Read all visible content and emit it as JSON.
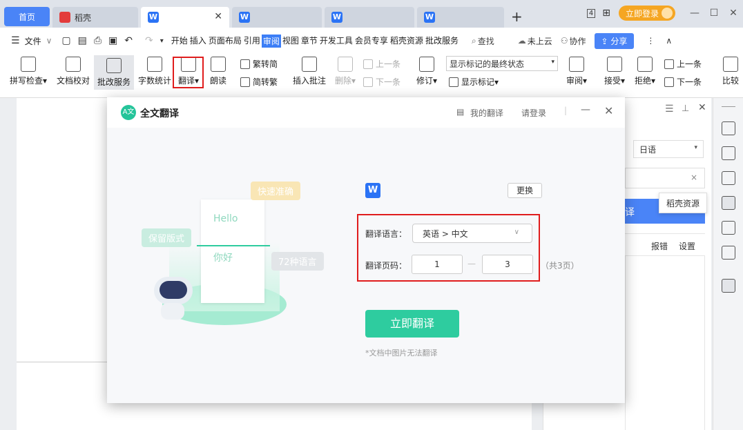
{
  "tabs": {
    "home": "首页",
    "docer": "稻壳",
    "doc_icon": "W"
  },
  "topbar": {
    "login": "立即登录",
    "grid_icon": "grid-icon",
    "window_icon": "4"
  },
  "menu": {
    "file": "文件",
    "items": [
      "开始",
      "插入",
      "页面布局",
      "引用",
      "审阅",
      "视图",
      "章节",
      "开发工具",
      "会员专享",
      "稻壳资源",
      "批改服务"
    ],
    "active": "审阅",
    "search": "查找",
    "cloud": "未上云",
    "collab": "协作",
    "share": "分享"
  },
  "ribbon": {
    "spell_check": "拼写检查",
    "doc_proof": "文档校对",
    "correction": "批改服务",
    "word_count": "字数统计",
    "translate": "翻译",
    "read_aloud": "朗读",
    "trad_to_simp": "繁转简",
    "simp_to_trad": "简转繁",
    "insert_comment": "插入批注",
    "delete": "删除",
    "prev": "上一条",
    "next": "下一条",
    "revise": "修订",
    "markup_state": "显示标记的最终状态",
    "show_markup": "显示标记",
    "review": "审阅",
    "accept": "接受",
    "reject": "拒绝",
    "prev2": "上一条",
    "next2": "下一条",
    "compare": "比较"
  },
  "side_panel": {
    "language": "日语",
    "clear_icon": "×",
    "action": "译",
    "report": "报错",
    "settings": "设置"
  },
  "tooltip": "稻壳资源",
  "dialog": {
    "title": "全文翻译",
    "logo": "A文",
    "my_translations": "我的翻译",
    "login": "请登录",
    "change": "更换",
    "doc_icon": "W",
    "lang_label": "翻译语言：",
    "lang_value": "英语 > 中文",
    "page_label": "翻译页码：",
    "page_from": "1",
    "page_sep": "—",
    "page_to": "3",
    "page_total": "（共3页）",
    "start": "立即翻译",
    "note": "*文档中图片无法翻译",
    "illustration": {
      "fast": "快速准确",
      "keep_format": "保留版式",
      "langs": "72种语言",
      "hello": "Hello",
      "nihao": "你好"
    }
  }
}
